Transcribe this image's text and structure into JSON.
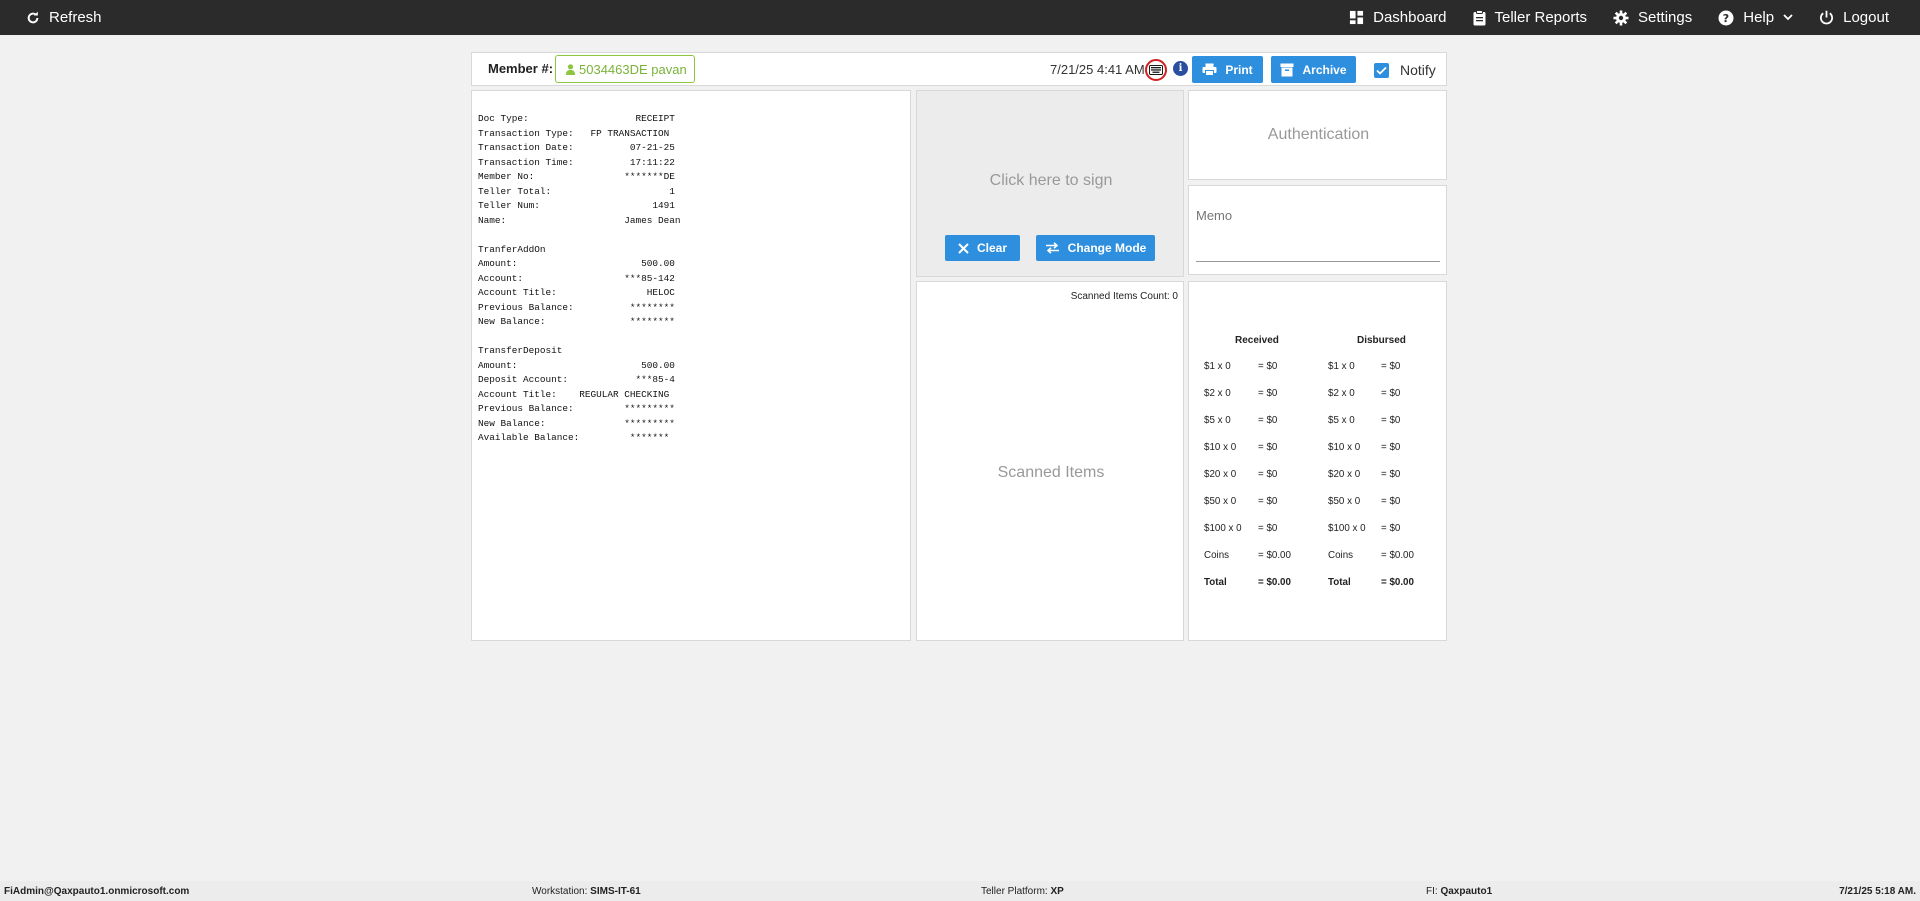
{
  "nav": {
    "refresh": "Refresh",
    "dashboard": "Dashboard",
    "teller_reports": "Teller Reports",
    "settings": "Settings",
    "help": "Help",
    "logout": "Logout"
  },
  "member": {
    "label": "Member #:",
    "value": "5034463DE pavan",
    "datetime": "7/21/25 4:41 AM",
    "print": "Print",
    "archive": "Archive",
    "notify": "Notify",
    "notify_checked": true
  },
  "receipt": {
    "lines": [
      "Doc Type:                   RECEIPT",
      "Transaction Type:   FP TRANSACTION",
      "Transaction Date:          07-21-25",
      "Transaction Time:          17:11:22",
      "Member No:                *******DE",
      "Teller Total:                     1",
      "Teller Num:                    1491",
      "Name:                     James Dean",
      "",
      "TranferAddOn",
      "Amount:                      500.00",
      "Account:                  ***85-142",
      "Account Title:                HELOC",
      "Previous Balance:          ********",
      "New Balance:               ********",
      "",
      "TransferDeposit",
      "Amount:                      500.00",
      "Deposit Account:            ***85-4",
      "Account Title:    REGULAR CHECKING",
      "Previous Balance:         *********",
      "New Balance:              *********",
      "Available Balance:         *******"
    ]
  },
  "signature": {
    "prompt": "Click here to sign",
    "clear": "Clear",
    "change_mode": "Change Mode"
  },
  "scanned": {
    "count_label": "Scanned Items Count: 0",
    "placeholder": "Scanned Items"
  },
  "authentication": {
    "label": "Authentication"
  },
  "memo": {
    "label": "Memo"
  },
  "cash": {
    "received_header": "Received",
    "disbursed_header": "Disbursed",
    "received": [
      {
        "denom": "$1 x 0",
        "total": "= $0"
      },
      {
        "denom": "$2 x 0",
        "total": "= $0"
      },
      {
        "denom": "$5 x 0",
        "total": "= $0"
      },
      {
        "denom": "$10 x 0",
        "total": "= $0"
      },
      {
        "denom": "$20 x 0",
        "total": "= $0"
      },
      {
        "denom": "$50 x 0",
        "total": "= $0"
      },
      {
        "denom": "$100 x 0",
        "total": "= $0"
      },
      {
        "denom": "Coins",
        "total": "= $0.00"
      },
      {
        "denom": "Total",
        "total": "= $0.00"
      }
    ],
    "disbursed": [
      {
        "denom": "$1 x 0",
        "total": "= $0"
      },
      {
        "denom": "$2 x 0",
        "total": "= $0"
      },
      {
        "denom": "$5 x 0",
        "total": "= $0"
      },
      {
        "denom": "$10 x 0",
        "total": "= $0"
      },
      {
        "denom": "$20 x 0",
        "total": "= $0"
      },
      {
        "denom": "$50 x 0",
        "total": "= $0"
      },
      {
        "denom": "$100 x 0",
        "total": "= $0"
      },
      {
        "denom": "Coins",
        "total": "= $0.00"
      },
      {
        "denom": "Total",
        "total": "= $0.00"
      }
    ]
  },
  "footer": {
    "user": "FiAdmin@Qaxpauto1.onmicrosoft.com",
    "workstation_label": "Workstation:",
    "workstation": "SIMS-IT-61",
    "platform_label": "Teller Platform:",
    "platform": "XP",
    "fi_label": "FI:",
    "fi": "Qaxpauto1",
    "datetime": "7/21/25 5:18 AM."
  },
  "colors": {
    "nav_bg": "#2b2b2b",
    "accent_blue": "#2f8fdf",
    "member_green": "#7ab33a",
    "highlight_red": "#d21e1e"
  }
}
